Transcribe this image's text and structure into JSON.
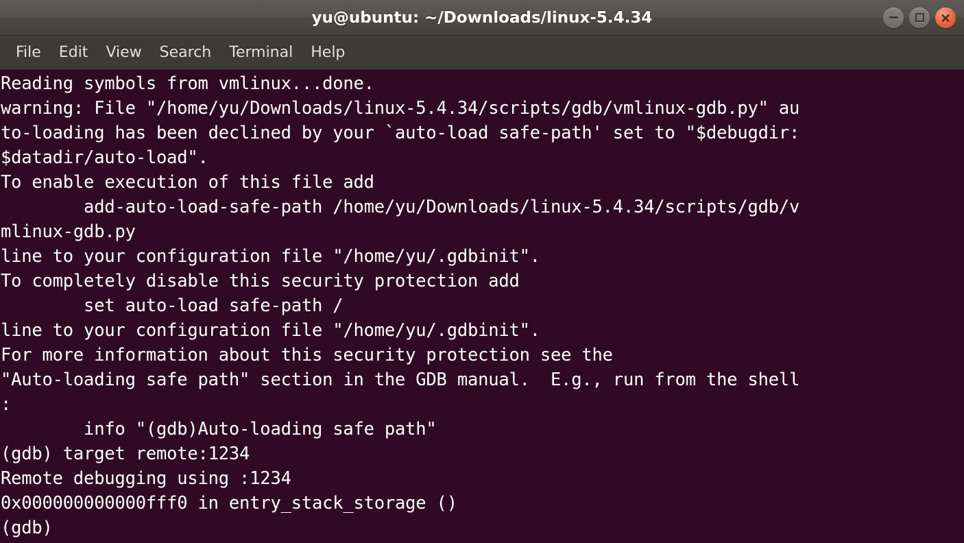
{
  "window": {
    "title": "yu@ubuntu: ~/Downloads/linux-5.4.34",
    "controls": {
      "minimize_label": "Minimize",
      "maximize_label": "Maximize",
      "close_label": "Close"
    },
    "colors": {
      "titlebar_top": "#5d5a55",
      "titlebar_bottom": "#45423d",
      "menubar": "#3c3b37",
      "terminal_background": "#300a24",
      "terminal_foreground": "#ffffff",
      "close_button": "#e8633b"
    }
  },
  "menubar": {
    "items": [
      {
        "label": "File"
      },
      {
        "label": "Edit"
      },
      {
        "label": "View"
      },
      {
        "label": "Search"
      },
      {
        "label": "Terminal"
      },
      {
        "label": "Help"
      }
    ]
  },
  "terminal": {
    "prompt": "(gdb)",
    "columns": 78,
    "lines": [
      "Reading symbols from vmlinux...done.",
      "warning: File \"/home/yu/Downloads/linux-5.4.34/scripts/gdb/vmlinux-gdb.py\" au",
      "to-loading has been declined by your `auto-load safe-path' set to \"$debugdir:",
      "$datadir/auto-load\".",
      "To enable execution of this file add",
      "        add-auto-load-safe-path /home/yu/Downloads/linux-5.4.34/scripts/gdb/v",
      "mlinux-gdb.py",
      "line to your configuration file \"/home/yu/.gdbinit\".",
      "To completely disable this security protection add",
      "        set auto-load safe-path /",
      "line to your configuration file \"/home/yu/.gdbinit\".",
      "For more information about this security protection see the",
      "\"Auto-loading safe path\" section in the GDB manual.  E.g., run from the shell",
      ":",
      "        info \"(gdb)Auto-loading safe path\"",
      "(gdb) target remote:1234",
      "Remote debugging using :1234",
      "0x000000000000fff0 in entry_stack_storage ()",
      "(gdb) "
    ]
  }
}
